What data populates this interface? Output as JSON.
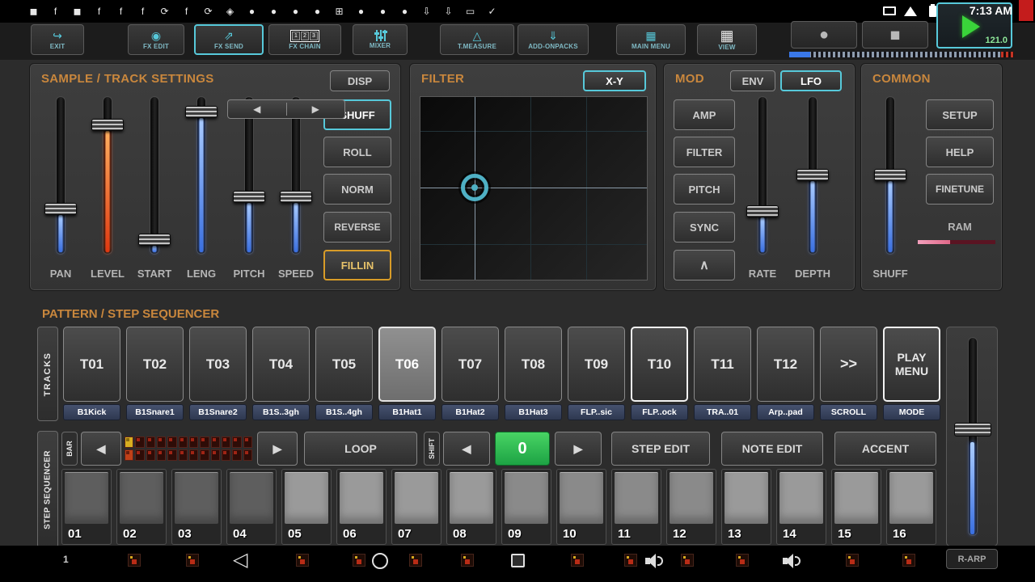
{
  "status_bar": {
    "time": "7:13 AM",
    "left_icons": [
      "◼",
      "f",
      "◼",
      "f",
      "f",
      "f",
      "⟳",
      "f",
      "⟳",
      "◈",
      "●",
      "●",
      "●",
      "●",
      "⊞",
      "●",
      "●",
      "●",
      "⇩",
      "⇩",
      "▭",
      "✓"
    ]
  },
  "toolbar": {
    "buttons": [
      {
        "label": "EXIT",
        "icon": "↪"
      },
      {
        "label": "FX EDIT",
        "icon": "◉"
      },
      {
        "label": "FX SEND",
        "icon": "⇗"
      },
      {
        "label": "FX CHAIN",
        "icon": ""
      },
      {
        "label": "MIXER",
        "icon": ""
      },
      {
        "label": "T.MEASURE",
        "icon": "△"
      },
      {
        "label": "ADD-ONPACKS",
        "icon": "⇓"
      },
      {
        "label": "MAIN MENU",
        "icon": "▦"
      },
      {
        "label": "VIEW",
        "icon": "▦"
      }
    ],
    "fx_chain_digits": [
      "1",
      "2",
      "3"
    ]
  },
  "transport": {
    "record_icon": "●",
    "stop_icon": "◼",
    "bpm": "121.0"
  },
  "sample_panel": {
    "title": "SAMPLE / TRACK SETTINGS",
    "disp_button": "DISP",
    "sliders": [
      "PAN",
      "LEVEL",
      "START",
      "LENG",
      "PITCH",
      "SPEED"
    ],
    "buttons": [
      "SHUFF",
      "ROLL",
      "NORM",
      "REVERSE",
      "FILLIN"
    ],
    "arrow_left": "◀",
    "arrow_right": "▶"
  },
  "filter_panel": {
    "title": "FILTER",
    "mode_button": "X-Y"
  },
  "mod_panel": {
    "title": "MOD",
    "env_button": "ENV",
    "lfo_button": "LFO",
    "buttons": [
      "AMP",
      "FILTER",
      "PITCH",
      "SYNC"
    ],
    "chevron_up": "∧",
    "sliders": [
      "RATE",
      "DEPTH"
    ]
  },
  "common_panel": {
    "title": "COMMON",
    "buttons": [
      "SETUP",
      "HELP",
      "FINETUNE"
    ],
    "ram_label": "RAM",
    "slider_label": "SHUFF"
  },
  "pattern_section": {
    "title": "PATTERN / STEP SEQUENCER",
    "tracks_tab": "TRACKS",
    "tracks": [
      {
        "id": "T01",
        "name": "B1Kick"
      },
      {
        "id": "T02",
        "name": "B1Snare1"
      },
      {
        "id": "T03",
        "name": "B1Snare2"
      },
      {
        "id": "T04",
        "name": "B1S..3gh"
      },
      {
        "id": "T05",
        "name": "B1S..4gh"
      },
      {
        "id": "T06",
        "name": "B1Hat1"
      },
      {
        "id": "T07",
        "name": "B1Hat2"
      },
      {
        "id": "T08",
        "name": "B1Hat3"
      },
      {
        "id": "T09",
        "name": "FLP..sic"
      },
      {
        "id": "T10",
        "name": "FLP..ock"
      },
      {
        "id": "T11",
        "name": "TRA..01"
      },
      {
        "id": "T12",
        "name": "Arp..pad"
      }
    ],
    "scroll_button": {
      "id": ">>",
      "name": "SCROLL"
    },
    "play_menu_button": {
      "id": "PLAY MENU",
      "name": "MODE"
    }
  },
  "sequencer": {
    "tab": "STEP SEQUENCER",
    "bar_label": "BAR",
    "prev_glyph": "◀",
    "next_glyph": "▶",
    "loop_button": "LOOP",
    "shift_label": "SHIFT",
    "position": "0",
    "step_edit_button": "STEP EDIT",
    "note_edit_button": "NOTE EDIT",
    "accent_button": "ACCENT",
    "steps": [
      "01",
      "02",
      "03",
      "04",
      "05",
      "06",
      "07",
      "08",
      "09",
      "10",
      "11",
      "12",
      "13",
      "14",
      "15",
      "16"
    ]
  },
  "bottom_bar": {
    "row_number": "1",
    "back_glyph": "◁",
    "rarp_button": "R-ARP"
  },
  "colors": {
    "accent_teal": "#57c9da",
    "header_orange": "#c9873d",
    "slider_blue": "#4a7de0",
    "level_red": "#e04818",
    "position_green": "#2db855",
    "fillin_orange": "#d89c28",
    "ram_pink": "#e87a9a",
    "play_green": "#3ad43a"
  }
}
